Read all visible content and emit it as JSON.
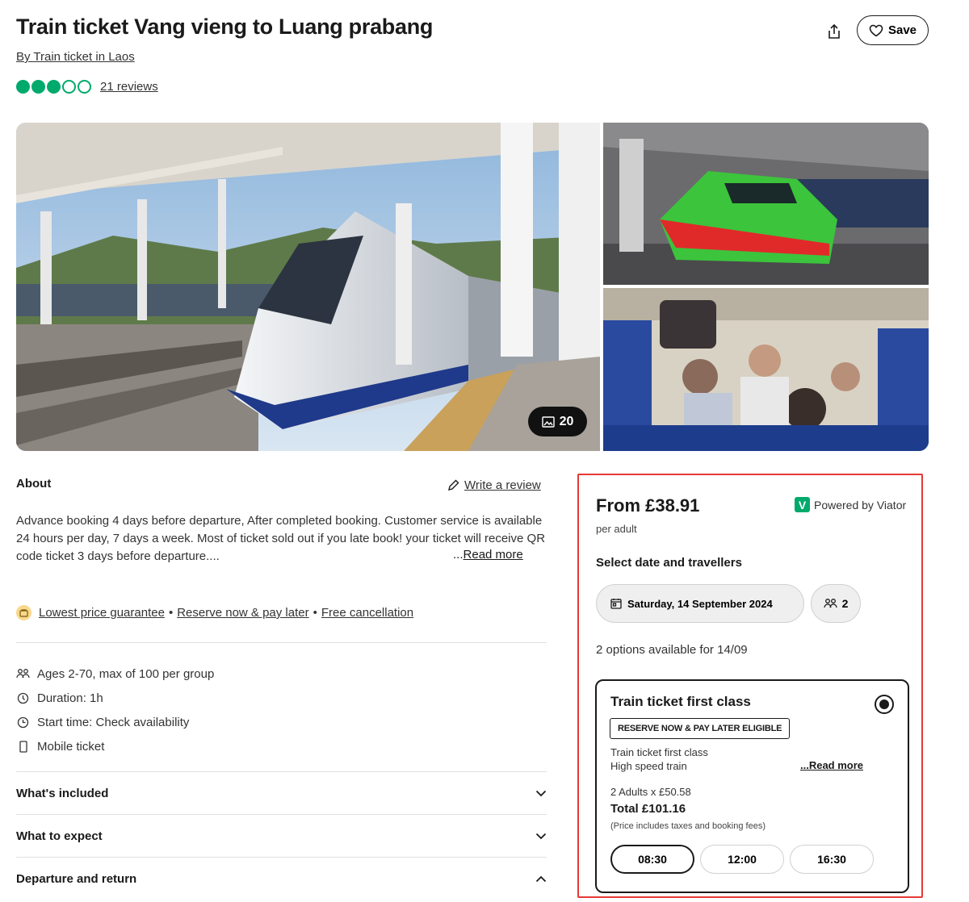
{
  "header": {
    "title": "Train ticket Vang vieng to Luang prabang",
    "byline": "By Train ticket in Laos",
    "rating": 3,
    "rating_max": 5,
    "reviews": "21 reviews",
    "save_label": "Save"
  },
  "gallery": {
    "photo_count": "20"
  },
  "about": {
    "heading": "About",
    "write_review": "Write a review",
    "text": "Advance booking 4 days before departure, After completed booking. Customer service is available 24 hours per day, 7 days a week. Most of ticket sold out if you late book! your ticket will receive QR code ticket 3 days before departure....",
    "read_more": "Read more",
    "read_more_prefix": "..."
  },
  "features": {
    "items": [
      "Lowest price guarantee",
      "Reserve now & pay later",
      "Free cancellation"
    ],
    "separator": "•"
  },
  "info": {
    "ages": "Ages 2-70, max of 100 per group",
    "duration": "Duration: 1h",
    "start_time": "Start time: Check availability",
    "ticket": "Mobile ticket"
  },
  "accordions": [
    {
      "label": "What's included",
      "expanded": false
    },
    {
      "label": "What to expect",
      "expanded": false
    },
    {
      "label": "Departure and return",
      "expanded": true
    }
  ],
  "booking": {
    "price": "From £38.91",
    "per": "per adult",
    "powered_by": "Powered by Viator",
    "logo_letter": "V",
    "select_heading": "Select date and travellers",
    "date": "Saturday, 14 September 2024",
    "travellers": "2",
    "options_available": "2 options available for 14/09",
    "option": {
      "title": "Train ticket first class",
      "badge": "RESERVE NOW & PAY LATER ELIGIBLE",
      "desc_line1": "Train ticket first class",
      "desc_line2": "High speed train",
      "read_more": "...Read more",
      "adults": "2 Adults x £50.58",
      "total": "Total £101.16",
      "note": "(Price includes taxes and booking fees)",
      "times": [
        "08:30",
        "12:00",
        "16:30"
      ],
      "selected_time": "08:30"
    }
  },
  "colors": {
    "brand_green": "#00aa6c",
    "highlight_red": "#e53935"
  }
}
